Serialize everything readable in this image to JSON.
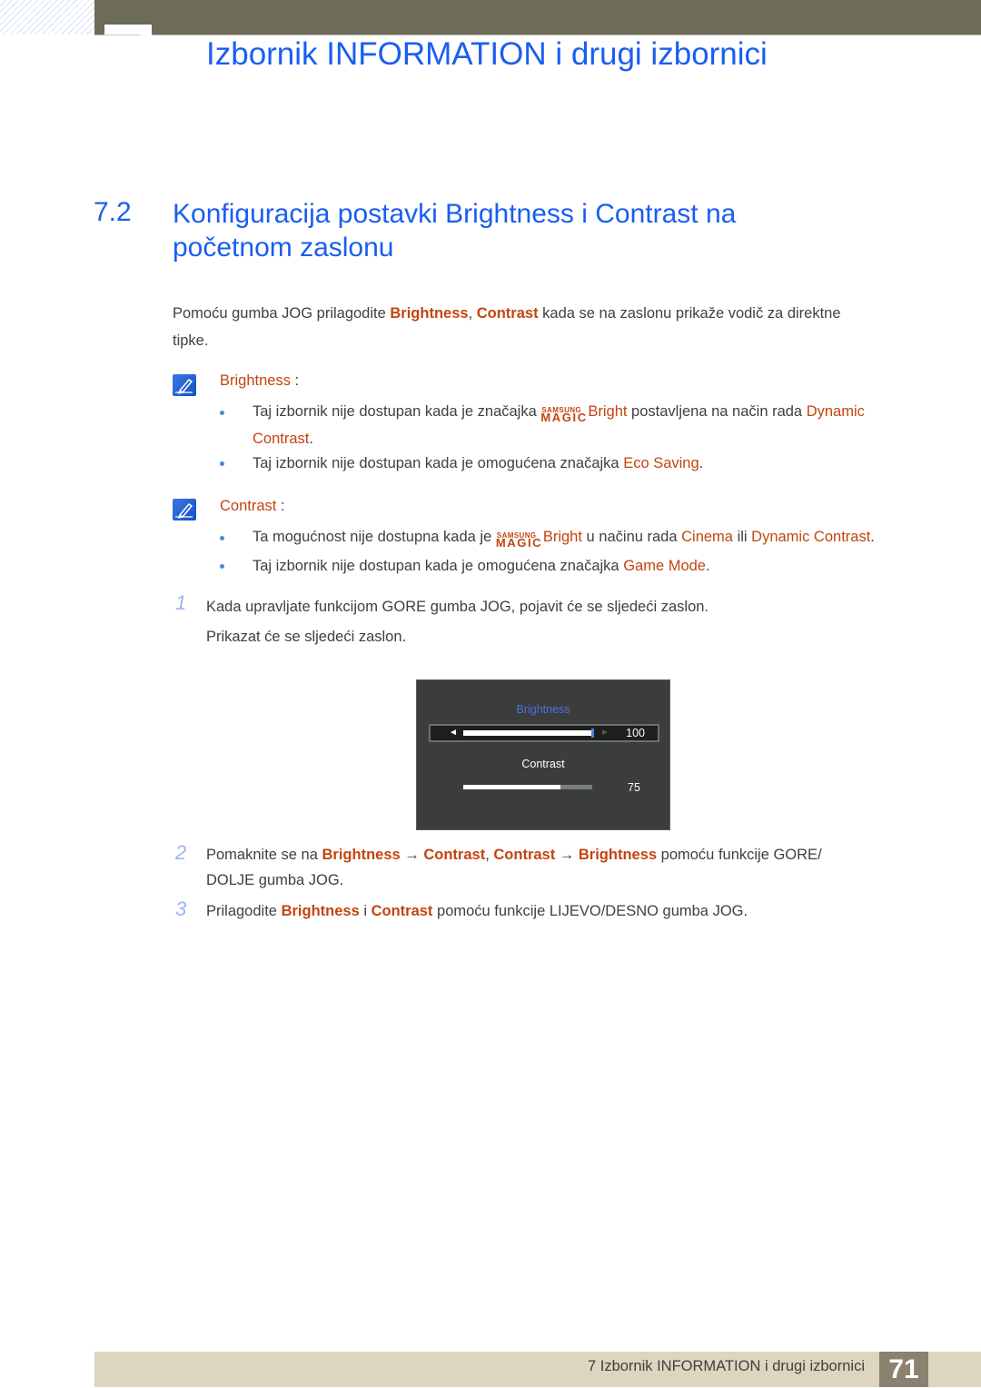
{
  "header": {
    "chapter_title": "Izbornik INFORMATION i drugi izbornici"
  },
  "section": {
    "number": "7.2",
    "title": "Konfiguracija postavki Brightness i Contrast na početnom zaslonu"
  },
  "intro": {
    "t1": "Pomoću gumba JOG prilagodite ",
    "h1": "Brightness",
    "t2": ", ",
    "h2": "Contrast",
    "t3": " kada se na zaslonu prikaže vodič za direktne",
    "t4": "tipke."
  },
  "notes": [
    {
      "label": "Brightness",
      "suffix": " :",
      "bullets": [
        {
          "t1": "Taj izbornik nije dostupan kada je značajka ",
          "magic_top": "SAMSUNG",
          "magic_bottom": "MAGIC",
          "magic_word": "Bright",
          "t2": " postavljena na način rada ",
          "h1": "Dynamic",
          "h2": "Contrast",
          "t3": "."
        },
        {
          "t1": "Taj izbornik nije dostupan kada je omogućena značajka ",
          "h1": "Eco Saving",
          "t2": "."
        }
      ]
    },
    {
      "label": "Contrast",
      "suffix": " :",
      "bullets": [
        {
          "t1": "Ta mogućnost nije dostupna kada je ",
          "magic_top": "SAMSUNG",
          "magic_bottom": "MAGIC",
          "magic_word": "Bright",
          "t2": " u načinu rada ",
          "h1": "Cinema",
          "t3": " ili ",
          "h2": "Dynamic Contrast",
          "t4": "."
        },
        {
          "t1": "Taj izbornik nije dostupan kada je omogućena značajka ",
          "h1": "Game Mode",
          "t2": "."
        }
      ]
    }
  ],
  "steps": [
    {
      "num": "1",
      "line1": "Kada upravljate funkcijom GORE gumba JOG, pojavit će se sljedeći zaslon.",
      "line2": "Prikazat će se sljedeći zaslon."
    },
    {
      "num": "2",
      "t1": "Pomaknite se na ",
      "h1": "Brightness",
      "arrow1": " → ",
      "h2": "Contrast",
      "t2": ", ",
      "h3": "Contrast",
      "arrow2": " → ",
      "h4": "Brightness",
      "t3": " pomoću funkcije GORE/",
      "t4": "DOLJE gumba JOG."
    },
    {
      "num": "3",
      "t1": "Prilagodite ",
      "h1": "Brightness",
      "t2": " i ",
      "h2": "Contrast",
      "t3": " pomoću funkcije LIJEVO/DESNO gumba JOG."
    }
  ],
  "osd": {
    "brightness_label": "Brightness",
    "brightness_value": "100",
    "brightness_percent": 100,
    "contrast_label": "Contrast",
    "contrast_value": "75",
    "contrast_percent": 75,
    "left_arrow": "◄",
    "right_arrow": "►",
    "colors": {
      "active_label": "#4d6fe0",
      "thumb": "#4a86e8"
    }
  },
  "footer": {
    "text": "7 Izbornik INFORMATION i drugi izbornici",
    "page": "71"
  },
  "colors": {
    "heading": "#1a5ef0",
    "highlight": "#c2450f",
    "topbar": "#6d6b59",
    "footer_bg": "#ddd5c0",
    "page_badge": "#8c8070"
  }
}
